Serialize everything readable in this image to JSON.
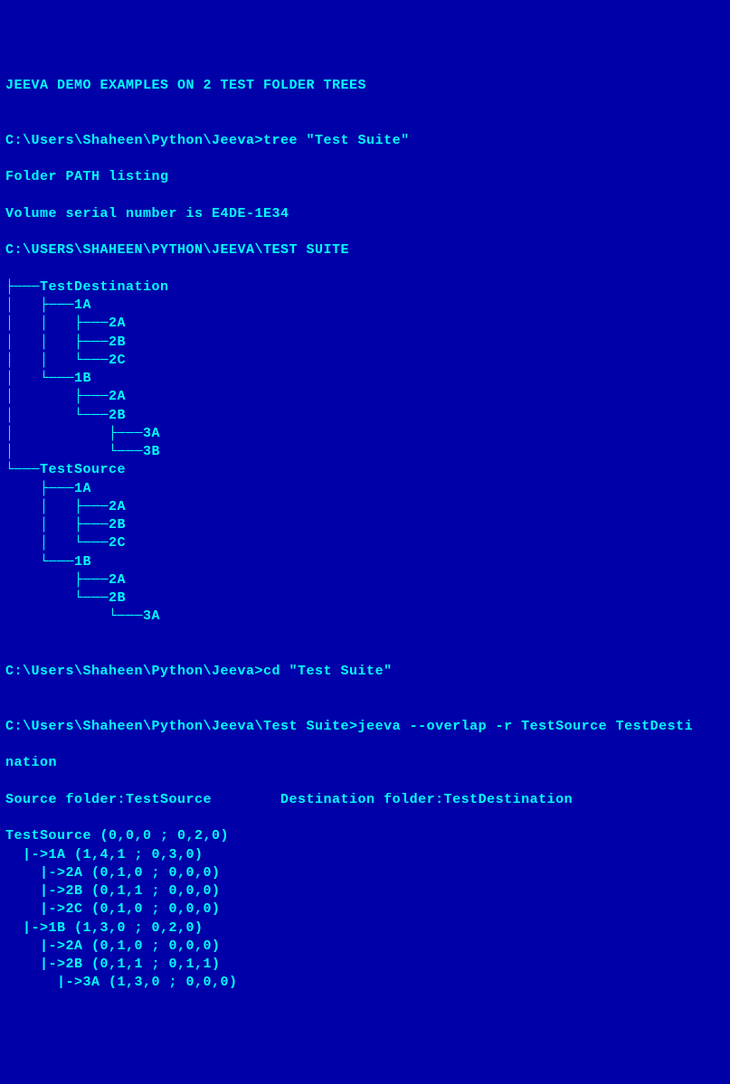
{
  "title": "JEEVA DEMO EXAMPLES ON 2 TEST FOLDER TREES",
  "blank1": "",
  "prompt1": "C:\\Users\\Shaheen\\Python\\Jeeva>tree \"Test Suite\"",
  "pathListing": "Folder PATH listing",
  "volumeSerial": "Volume serial number is E4DE-1E34",
  "rootPath": "C:\\USERS\\SHAHEEN\\PYTHON\\JEEVA\\TEST SUITE",
  "tree": [
    "├───TestDestination",
    "│   ├───1A",
    "│   │   ├───2A",
    "│   │   ├───2B",
    "│   │   └───2C",
    "│   └───1B",
    "│       ├───2A",
    "│       └───2B",
    "│           ├───3A",
    "│           └───3B",
    "└───TestSource",
    "    ├───1A",
    "    │   ├───2A",
    "    │   ├───2B",
    "    │   └───2C",
    "    └───1B",
    "        ├───2A",
    "        └───2B",
    "            └───3A"
  ],
  "blank2": "",
  "prompt2": "C:\\Users\\Shaheen\\Python\\Jeeva>cd \"Test Suite\"",
  "blank3": "",
  "prompt3a": "C:\\Users\\Shaheen\\Python\\Jeeva\\Test Suite>jeeva --overlap -r TestSource TestDesti",
  "prompt3b": "nation",
  "sourceDest": "Source folder:TestSource        Destination folder:TestDestination",
  "results": [
    "TestSource (0,0,0 ; 0,2,0)",
    "  |->1A (1,4,1 ; 0,3,0)",
    "    |->2A (0,1,0 ; 0,0,0)",
    "    |->2B (0,1,1 ; 0,0,0)",
    "    |->2C (0,1,0 ; 0,0,0)",
    "  |->1B (1,3,0 ; 0,2,0)",
    "    |->2A (0,1,0 ; 0,0,0)",
    "    |->2B (0,1,1 ; 0,1,1)",
    "      |->3A (1,3,0 ; 0,0,0)"
  ]
}
